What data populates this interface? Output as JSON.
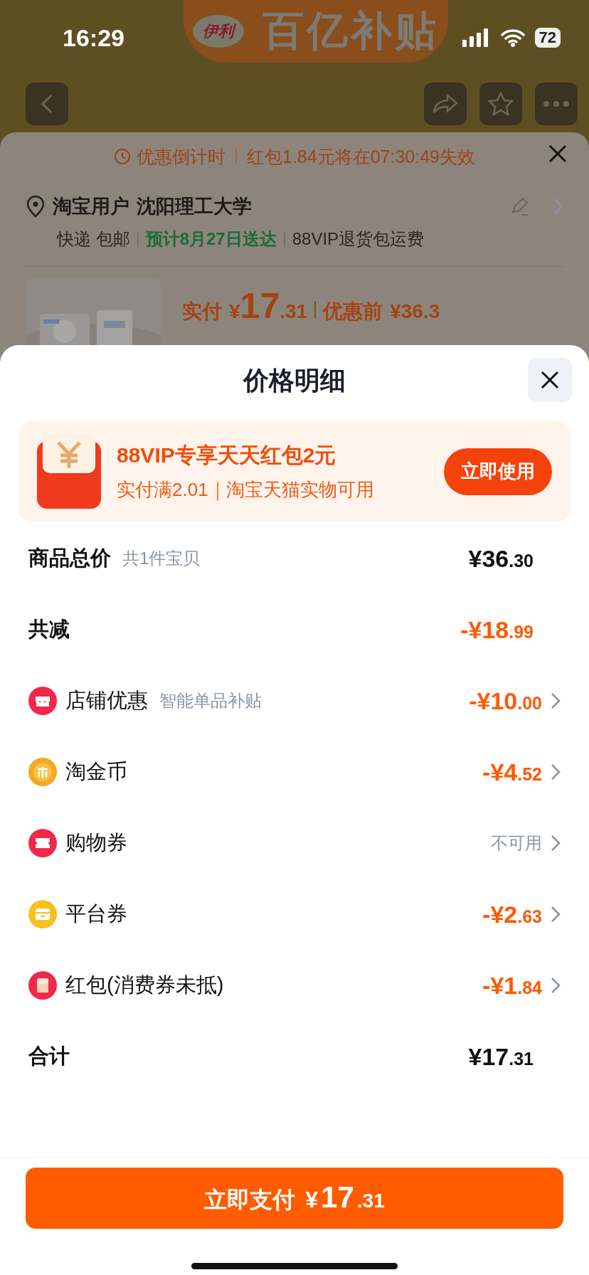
{
  "status_bar": {
    "time": "16:29",
    "battery": "72"
  },
  "banner": {
    "logo": "伊利",
    "title": "百亿补贴"
  },
  "order_card": {
    "countdown_label": "优惠倒计时",
    "countdown_text": "红包1.84元将在07:30:49失效",
    "address": {
      "name": "淘宝用户",
      "place": "沈阳理工大学"
    },
    "delivery": [
      {
        "text": "快递 包邮",
        "kind": "plain"
      },
      {
        "text": "预计8月27日送达",
        "kind": "eta"
      },
      {
        "text": "88VIP退货包运费",
        "kind": "plain"
      }
    ],
    "price": {
      "paid_label": "实付",
      "paid_amount": "¥17.31",
      "before_label": "优惠前",
      "before_amount": "¥36.3"
    }
  },
  "sheet": {
    "title": "价格明细",
    "promo": {
      "title": "88VIP专享天天红包2元",
      "subtitle": "实付满2.01｜淘宝天猫实物可用",
      "button": "立即使用"
    },
    "rows": [
      {
        "kind": "total",
        "label": "商品总价",
        "note": "共1件宝贝",
        "amount": "¥36.30"
      },
      {
        "kind": "reduce",
        "label": "共减",
        "amount": "-¥18.99"
      },
      {
        "kind": "shop",
        "label": "店铺优惠",
        "note": "智能单品补贴",
        "amount": "-¥10.00",
        "available": true
      },
      {
        "kind": "coin",
        "label": "淘金币",
        "amount": "-¥4.52",
        "available": true
      },
      {
        "kind": "ticket",
        "label": "购物券",
        "amount": "不可用",
        "available": false
      },
      {
        "kind": "card",
        "label": "平台券",
        "amount": "-¥2.63",
        "available": true
      },
      {
        "kind": "packet",
        "label": "红包(消费券未抵)",
        "amount": "-¥1.84",
        "available": true
      },
      {
        "kind": "total",
        "label": "合计",
        "amount": "¥17.31"
      }
    ],
    "pay_button": {
      "label": "立即支付",
      "amount": "¥17.31"
    }
  }
}
